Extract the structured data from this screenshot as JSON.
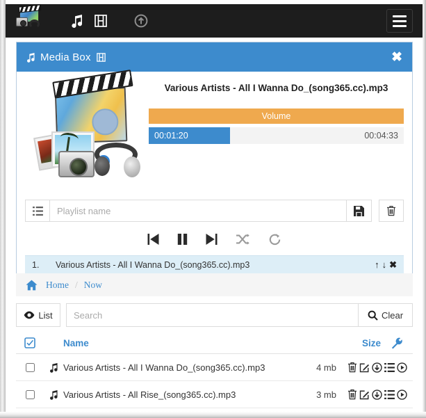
{
  "navbar": {
    "brand_icon": "media-collage-logo",
    "items": [
      {
        "icon": "music-note-icon",
        "name": "nav-music"
      },
      {
        "icon": "film-icon",
        "name": "nav-video"
      },
      {
        "icon": "upload-circle-icon",
        "name": "nav-upload"
      }
    ],
    "menu_button": "hamburger-menu-icon"
  },
  "mediabox": {
    "title": "Media Box",
    "title_left_icon": "music-note-icon",
    "title_right_icon": "film-icon",
    "close_label": "✖",
    "artwork_icon": "media-collage-artwork",
    "track_title": "Various Artists - All I Wanna Do_(song365.cc).mp3",
    "volume_label": "Volume",
    "volume_color": "#efa94e",
    "progress_color": "#3d8bcd",
    "header_color": "#3d8bcd",
    "current_time": "00:01:20",
    "total_time": "00:04:33",
    "progress_percent": 32,
    "playlist": {
      "list_icon": "list-icon",
      "input_placeholder": "Playlist name",
      "input_value": "",
      "save_icon": "floppy-save-icon",
      "delete_icon": "trash-icon"
    },
    "controls": [
      {
        "icon": "previous-icon",
        "name": "previous-button"
      },
      {
        "icon": "pause-icon",
        "name": "pause-button"
      },
      {
        "icon": "next-icon",
        "name": "next-button"
      },
      {
        "icon": "shuffle-icon",
        "name": "shuffle-button"
      },
      {
        "icon": "repeat-icon",
        "name": "repeat-button"
      }
    ],
    "now_playing": [
      {
        "index": "1.",
        "name": "Various Artists - All I Wanna Do_(song365.cc).mp3",
        "up": "↑",
        "down": "↓",
        "remove": "✖"
      }
    ]
  },
  "breadcrumb": {
    "home_icon": "home-icon",
    "home": "Home",
    "separator": "/",
    "current": "Now"
  },
  "search": {
    "list_icon": "eye-icon",
    "list_label": "List",
    "placeholder": "Search",
    "value": "",
    "clear_icon": "search-icon",
    "clear_label": "Clear"
  },
  "table": {
    "header": {
      "select_all_icon": "check-square-icon",
      "name": "Name",
      "size": "Size",
      "tools_icon": "wrench-icon",
      "accent_color": "#3d8bcd"
    },
    "rows": [
      {
        "checked": false,
        "type_icon": "music-note-icon",
        "name": "Various Artists - All I Wanna Do_(song365.cc).mp3",
        "size": "4 mb",
        "actions": [
          "trash-icon",
          "edit-icon",
          "download-icon",
          "list-icon",
          "play-icon"
        ]
      },
      {
        "checked": false,
        "type_icon": "music-note-icon",
        "name": "Various Artists - All Rise_(song365.cc).mp3",
        "size": "3 mb",
        "actions": [
          "trash-icon",
          "edit-icon",
          "download-icon",
          "list-icon",
          "play-icon"
        ]
      }
    ]
  }
}
